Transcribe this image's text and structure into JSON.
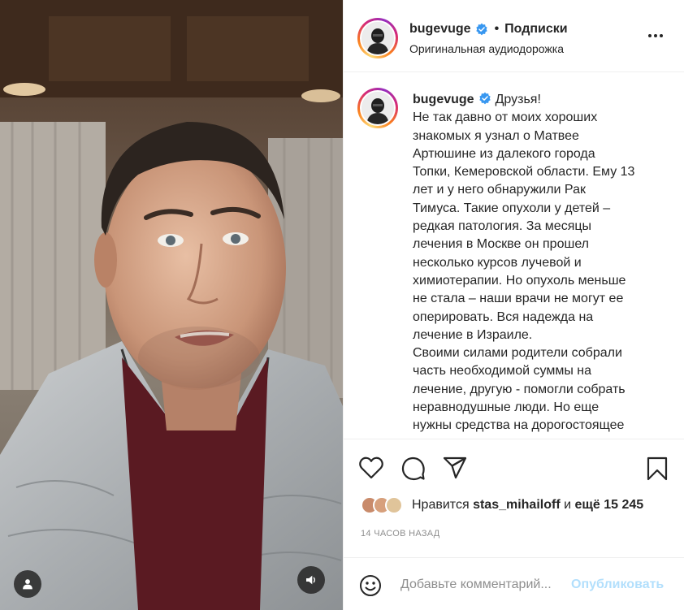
{
  "post": {
    "author": "bugevuge",
    "follow_label": "Подписки",
    "dot": "•",
    "audio_label": "Оригинальная аудиодорожка"
  },
  "caption": {
    "username": "bugevuge",
    "lines": [
      "Друзья!",
      "Не так давно от моих хороших",
      "знакомых я узнал о Матвее",
      "Артюшине из далекого города",
      "Топки, Кемеровской области. Ему 13",
      "лет и у него обнаружили Рак",
      "Тимуса. Такие опухоли у детей –",
      "редкая патология. За месяцы",
      "лечения в Москве он прошел",
      "несколько курсов лучевой и",
      "химиотерапии. Но опухоль меньше",
      "не стала – наши врачи не могут ее",
      "оперировать. Вся надежда на",
      "лечение в Израиле.",
      "Своими силами родители собрали",
      "часть необходимой суммы на",
      "лечение, другую - помогли собрать",
      "неравнодушные люди. Но еще",
      "нужны средства на дорогостоящее"
    ]
  },
  "likes": {
    "prefix": "Нравится",
    "liked_by": "stas_mihailoff",
    "conjunction": "и",
    "others": "ещё 15 245"
  },
  "timestamp": "14 ЧАСОВ НАЗАД",
  "comment": {
    "placeholder": "Добавьте комментарий...",
    "publish_label": "Опубликовать"
  },
  "icons": {
    "verified": "verified-badge-icon",
    "more": "more-options-icon",
    "like": "heart-icon",
    "comment": "comment-bubble-icon",
    "share": "paper-plane-icon",
    "save": "bookmark-icon",
    "emoji": "smiley-icon",
    "user_tag": "user-tag-icon",
    "sound": "speaker-icon"
  },
  "colors": {
    "verified": "#3897f0",
    "publish_disabled": "#b2dffc",
    "timestamp": "#8e8e8e"
  }
}
